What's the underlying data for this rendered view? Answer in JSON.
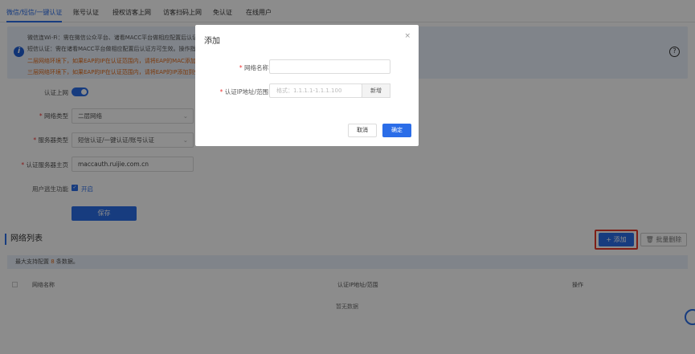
{
  "tabs": [
    "微信/短信/一键认证",
    "账号认证",
    "授权访客上网",
    "访客扫码上网",
    "免认证",
    "在线用户"
  ],
  "notice": {
    "lines": [
      "微信连Wi-Fi：需在微信公众平台、诸看MACC平台做相应配置后认证方可生效",
      "短信认证：需在诸看MACC平台做相应配置后认证方可生效。操作指南请",
      "二层网络环境下，如果EAP的IP在认证范围内，请将EAP的MAC添加到",
      "三层网络环境下，如果EAP的IP在认证范围内，请将EAP的IP添加到免认"
    ]
  },
  "form": {
    "auth_online_label": "认证上网",
    "network_type_label": "网络类型",
    "network_type_value": "二层网络",
    "server_type_label": "服务器类型",
    "server_type_value": "短信认证/一键认证/账号认证",
    "homepage_label": "认证服务器主页",
    "homepage_value": "maccauth.ruijie.com.cn",
    "escape_label": "用户逃生功能",
    "escape_value": "开启",
    "save": "保存"
  },
  "list": {
    "title": "网络列表",
    "add": "+ 添加",
    "batch_delete": "批量删除",
    "tip_prefix": "最大支持配置 ",
    "tip_count": "8",
    "tip_suffix": " 条数据。",
    "columns": [
      "网络名称",
      "认证IP地址/范围",
      "操作"
    ],
    "empty": "暂无数据"
  },
  "dialog": {
    "title": "添加",
    "close": "×",
    "name_label": "网络名称",
    "name_value": "",
    "ip_label": "认证IP地址/范围",
    "ip_placeholder": "格式：1.1.1.1-1.1.1.100",
    "new": "新增",
    "cancel": "取消",
    "ok": "确定"
  }
}
